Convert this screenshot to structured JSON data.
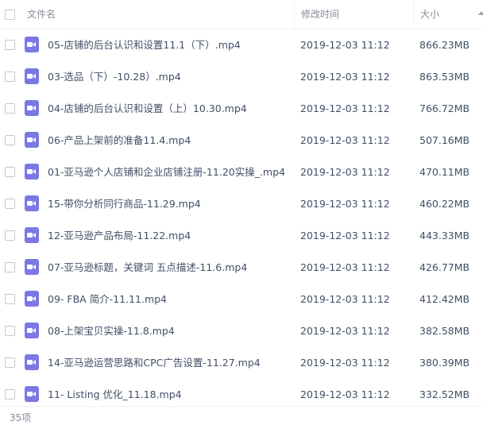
{
  "header": {
    "name_label": "文件名",
    "time_label": "修改时间",
    "size_label": "大小"
  },
  "files": [
    {
      "name": "05-店铺的后台认识和设置11.1（下）.mp4",
      "time": "2019-12-03 11:12",
      "size": "866.23MB"
    },
    {
      "name": "03-选品（下）-10.28）.mp4",
      "time": "2019-12-03 11:12",
      "size": "863.53MB"
    },
    {
      "name": "04-店铺的后台认识和设置（上）10.30.mp4",
      "time": "2019-12-03 11:12",
      "size": "766.72MB"
    },
    {
      "name": "06-产品上架前的准备11.4.mp4",
      "time": "2019-12-03 11:12",
      "size": "507.16MB"
    },
    {
      "name": "01-亚马逊个人店铺和企业店铺注册-11.20实操_.mp4",
      "time": "2019-12-03 11:12",
      "size": "470.11MB"
    },
    {
      "name": "15-带你分析同行商品-11.29.mp4",
      "time": "2019-12-03 11:12",
      "size": "460.22MB"
    },
    {
      "name": "12-亚马逊产品布局-11.22.mp4",
      "time": "2019-12-03 11:12",
      "size": "443.33MB"
    },
    {
      "name": "07-亚马逊标题，关键词 五点描述-11.6.mp4",
      "time": "2019-12-03 11:12",
      "size": "426.77MB"
    },
    {
      "name": "09- FBA 简介-11.11.mp4",
      "time": "2019-12-03 11:12",
      "size": "412.42MB"
    },
    {
      "name": "08-上架宝贝实操-11.8.mp4",
      "time": "2019-12-03 11:12",
      "size": "382.58MB"
    },
    {
      "name": "14-亚马逊运营思路和CPC广告设置-11.27.mp4",
      "time": "2019-12-03 11:12",
      "size": "380.39MB"
    },
    {
      "name": "11- Listing 优化_11.18.mp4",
      "time": "2019-12-03 11:12",
      "size": "332.52MB"
    }
  ],
  "footer": {
    "count": "35项"
  },
  "colors": {
    "video_icon": "#7b78e5",
    "text": "#424e67",
    "muted": "#878c9c"
  },
  "icons": {
    "file": "video-file-icon",
    "sort": "sort-arrow-icon"
  }
}
